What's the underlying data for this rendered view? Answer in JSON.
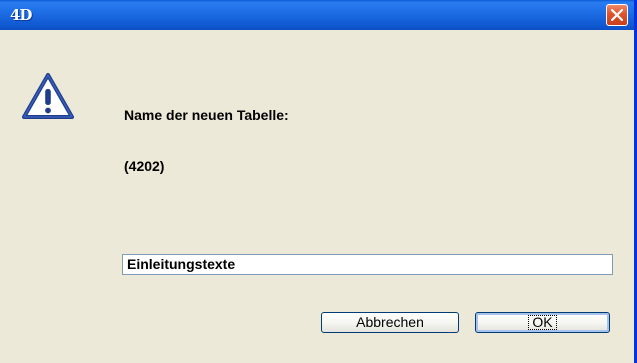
{
  "window": {
    "app_logo": "4D",
    "close_icon": "close-icon",
    "accent": "#0a5bd6",
    "close_color": "#e0522c"
  },
  "dialog": {
    "icon": "warning-icon",
    "message_line1": "Name der neuen Tabelle:",
    "message_line2": "(4202)",
    "input_value": "Einleitungstexte"
  },
  "buttons": {
    "cancel_label": "Abbrechen",
    "ok_label": "OK"
  }
}
